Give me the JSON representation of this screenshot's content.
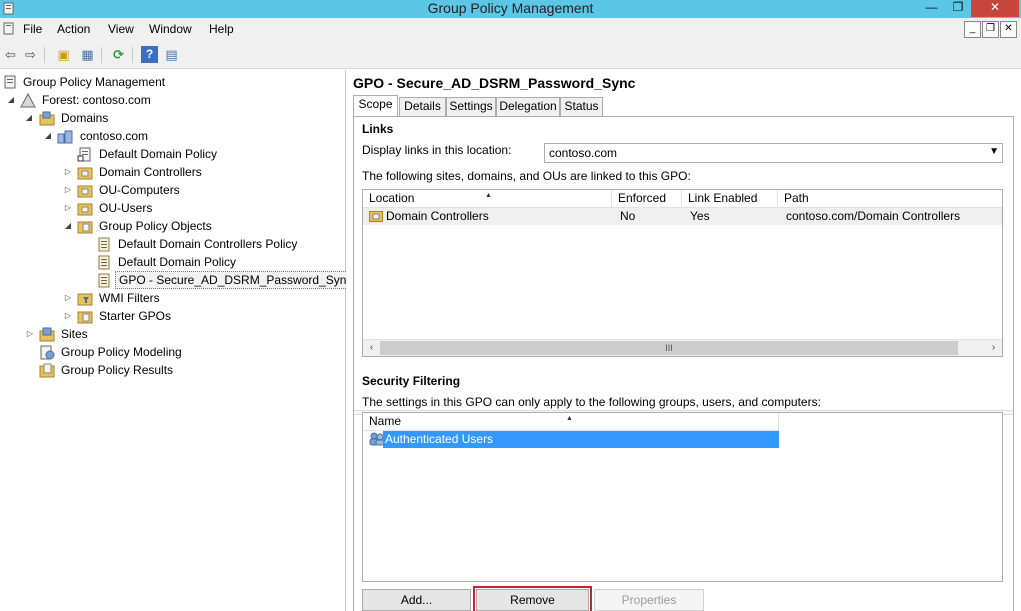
{
  "window": {
    "title": "Group Policy Management"
  },
  "titlebar_buttons": {
    "minimize": "—",
    "restore": "❐",
    "close": "✕"
  },
  "menu": {
    "items": [
      "File",
      "Action",
      "View",
      "Window",
      "Help"
    ]
  },
  "mdi_buttons": {
    "minimize": "_",
    "restore": "❐",
    "close": "✕"
  },
  "toolbar": {
    "back_glyph": "⇦",
    "forward_glyph": "⇨",
    "folder_up_glyph": "▣",
    "show_hide_glyph": "▦",
    "refresh_glyph": "⟳",
    "help_glyph": "?",
    "view_glyph": "▤"
  },
  "tree": {
    "root": "Group Policy Management",
    "forest": "Forest: contoso.com",
    "domains": "Domains",
    "domain": "contoso.com",
    "default_domain_policy": "Default Domain Policy",
    "domain_controllers": "Domain Controllers",
    "ou_computers": "OU-Computers",
    "ou_users": "OU-Users",
    "gpo_container": "Group Policy Objects",
    "gpo_items": [
      "Default Domain Controllers Policy",
      "Default Domain Policy",
      "GPO - Secure_AD_DSRM_Password_Sync"
    ],
    "wmi_filters": "WMI Filters",
    "starter_gpos": "Starter GPOs",
    "sites": "Sites",
    "modeling": "Group Policy Modeling",
    "results": "Group Policy Results"
  },
  "gpo": {
    "title": "GPO - Secure_AD_DSRM_Password_Sync",
    "tabs": [
      "Scope",
      "Details",
      "Settings",
      "Delegation",
      "Status"
    ],
    "active_tab": "Scope"
  },
  "links": {
    "heading": "Links",
    "display_label": "Display links in this location:",
    "display_value": "contoso.com",
    "description": "The following sites, domains, and OUs are linked to this GPO:",
    "columns": [
      "Location",
      "Enforced",
      "Link Enabled",
      "Path"
    ],
    "rows": [
      {
        "location": "Domain Controllers",
        "enforced": "No",
        "link_enabled": "Yes",
        "path": "contoso.com/Domain Controllers"
      }
    ],
    "scroll_grip": "III"
  },
  "security_filtering": {
    "heading": "Security Filtering",
    "description": "The settings in this GPO can only apply to the following groups, users, and computers:",
    "columns": [
      "Name"
    ],
    "rows": [
      {
        "name": "Authenticated Users"
      }
    ]
  },
  "buttons": {
    "add": "Add...",
    "remove": "Remove",
    "properties": "Properties"
  },
  "colors": {
    "title_bar": "#5bc6e6",
    "close": "#c7463b",
    "selection": "#3399ff",
    "highlight_box": "#c0282e"
  }
}
